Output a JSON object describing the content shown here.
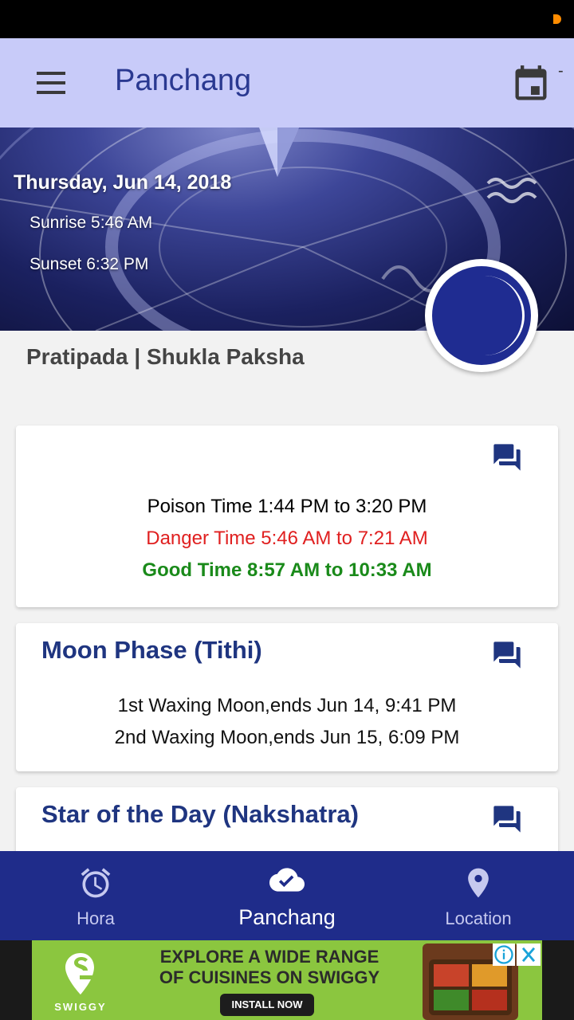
{
  "app_bar": {
    "title": "Panchang",
    "trailing_text": "-"
  },
  "hero": {
    "date": "Thursday, Jun 14, 2018",
    "sunrise": "Sunrise 5:46 AM",
    "sunset": "Sunset 6:32 PM"
  },
  "tithi_summary": "Pratipada | Shukla Paksha",
  "timings_card": {
    "poison": "Poison Time 1:44 PM to 3:20 PM",
    "danger": "Danger Time 5:46 AM to 7:21 AM",
    "good": "Good Time 8:57 AM to 10:33 AM",
    "colors": {
      "poison": "#000000",
      "danger": "#e02020",
      "good": "#1a8a1a"
    }
  },
  "moon_phase_card": {
    "title": "Moon Phase (Tithi)",
    "lines": [
      "1st Waxing Moon,ends Jun 14, 9:41 PM",
      "2nd Waxing Moon,ends Jun 15, 6:09 PM"
    ]
  },
  "nakshatra_card": {
    "title": "Star of the Day (Nakshatra)"
  },
  "bottom_nav": {
    "items": [
      {
        "label": "Hora",
        "icon": "alarm-clock-icon"
      },
      {
        "label": "Panchang",
        "icon": "cloud-check-icon",
        "active": true
      },
      {
        "label": "Location",
        "icon": "location-pin-icon"
      }
    ]
  },
  "ad": {
    "brand": "SWIGGY",
    "headline_line1": "EXPLORE A WIDE RANGE",
    "headline_line2": "OF CUISINES ON SWIGGY",
    "cta": "INSTALL NOW"
  },
  "colors": {
    "accent": "#1f2c8a",
    "app_bar": "#c8cbf9",
    "title": "#2a3991",
    "card_title": "#1f3580"
  }
}
